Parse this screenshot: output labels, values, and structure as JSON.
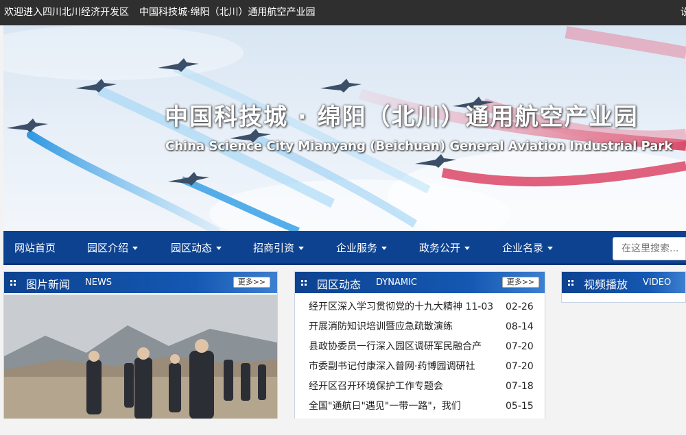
{
  "topbar": {
    "welcome": "欢迎进入四川北川经济开发区",
    "site_name": "中国科技城·绵阳（北川）通用航空产业园",
    "right_glyph": "设"
  },
  "banner": {
    "title": "中国科技城 · 绵阳（北川）通用航空产业园",
    "subtitle": "China Science City Mianyang (Beichuan) General Aviation Industrial Park"
  },
  "nav": {
    "items": [
      {
        "label": "网站首页",
        "dropdown": false
      },
      {
        "label": "园区介绍",
        "dropdown": true
      },
      {
        "label": "园区动态",
        "dropdown": true
      },
      {
        "label": "招商引资",
        "dropdown": true
      },
      {
        "label": "企业服务",
        "dropdown": true
      },
      {
        "label": "政务公开",
        "dropdown": true
      },
      {
        "label": "企业名录",
        "dropdown": true
      }
    ],
    "search_placeholder": "在这里搜索..."
  },
  "panels": {
    "photo_news": {
      "title_cn": "图片新闻",
      "title_en": "NEWS",
      "more": "更多>>"
    },
    "dynamic": {
      "title_cn": "园区动态",
      "title_en": "DYNAMIC",
      "more": "更多>>",
      "items": [
        {
          "title": "经开区深入学习贯彻党的十九大精神  11-03",
          "date": "02-26"
        },
        {
          "title": "开展消防知识培训暨应急疏散演练",
          "date": "08-14"
        },
        {
          "title": "县政协委员一行深入园区调研军民融合产",
          "date": "07-20"
        },
        {
          "title": "市委副书记付康深入普网·药博园调研社",
          "date": "07-20"
        },
        {
          "title": "经开区召开环境保护工作专题会",
          "date": "07-18"
        },
        {
          "title": "全国\"通航日\"遇见\"一带一路\"，我们",
          "date": "05-15"
        }
      ]
    },
    "video": {
      "title_cn": "视频播放",
      "title_en": "VIDEO"
    }
  },
  "colors": {
    "topbar": "#2f2f2f",
    "nav": "#0d4290",
    "panel_header": "#1458b3"
  }
}
